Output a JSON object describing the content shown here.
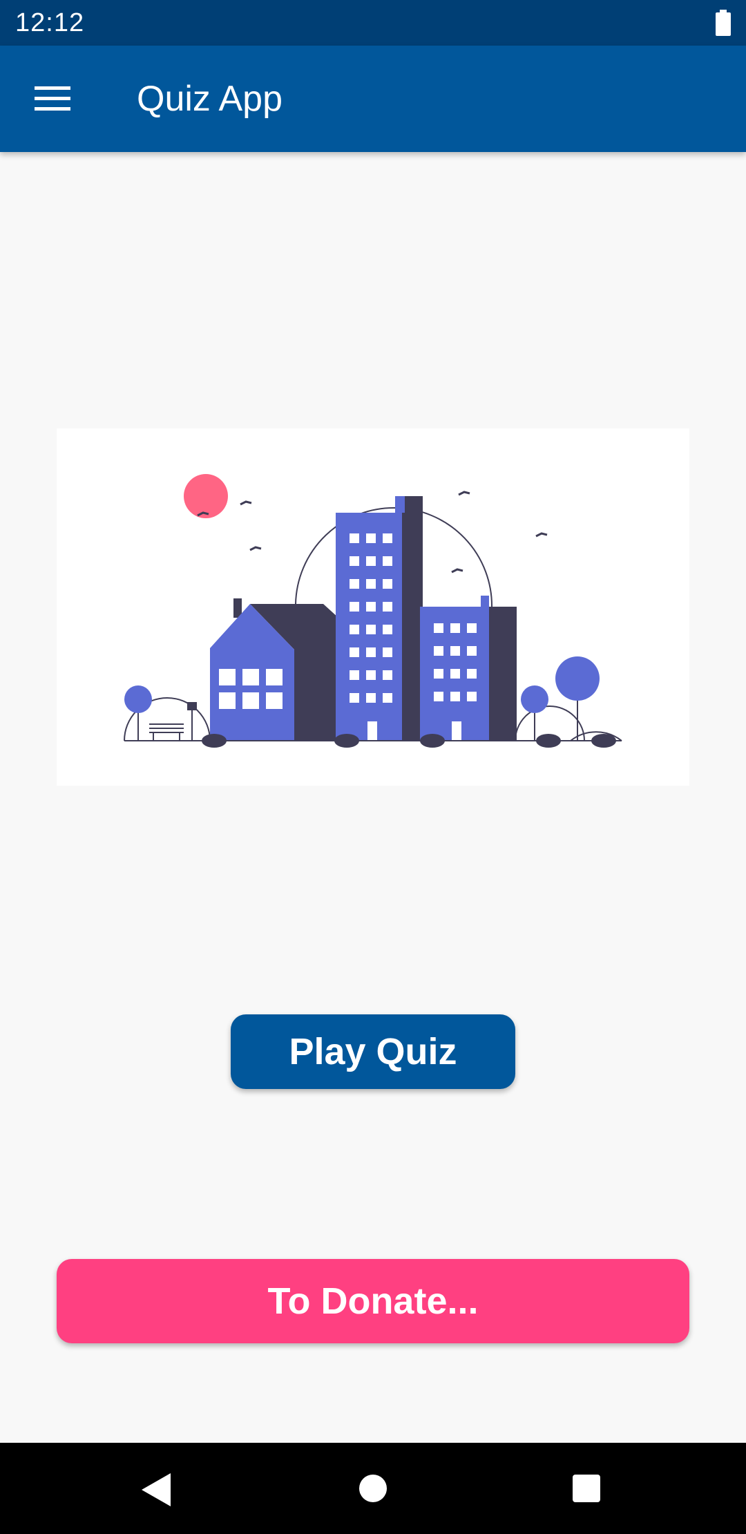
{
  "status_bar": {
    "time": "12:12",
    "battery_icon": "battery-full-icon"
  },
  "app_bar": {
    "menu_icon": "hamburger-menu-icon",
    "title": "Quiz App",
    "color": "#01579b"
  },
  "illustration": {
    "icon": "city-buildings-illustration",
    "colors": {
      "building": "#5b6bd4",
      "shadow": "#3f3d56",
      "sun": "#ff6584"
    }
  },
  "buttons": {
    "play_quiz": "Play Quiz",
    "donate": "To Donate..."
  },
  "colors": {
    "primary": "#01579b",
    "status_bar": "#003f75",
    "accent": "#ff4081",
    "background": "#f8f8f8"
  },
  "nav_bar": {
    "back_icon": "back-triangle-icon",
    "home_icon": "home-circle-icon",
    "recents_icon": "recents-square-icon"
  }
}
